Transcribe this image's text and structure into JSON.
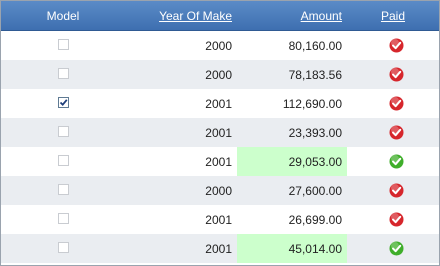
{
  "columns": {
    "model": "Model",
    "year": "Year Of Make",
    "amount": "Amount",
    "paid": "Paid"
  },
  "rows": [
    {
      "checked": false,
      "year": "2000",
      "amount": "80,160.00",
      "paid": "no",
      "highlight": false
    },
    {
      "checked": false,
      "year": "2000",
      "amount": "78,183.56",
      "paid": "no",
      "highlight": false
    },
    {
      "checked": true,
      "year": "2001",
      "amount": "112,690.00",
      "paid": "no",
      "highlight": false
    },
    {
      "checked": false,
      "year": "2001",
      "amount": "23,393.00",
      "paid": "no",
      "highlight": false
    },
    {
      "checked": false,
      "year": "2001",
      "amount": "29,053.00",
      "paid": "yes",
      "highlight": true
    },
    {
      "checked": false,
      "year": "2000",
      "amount": "27,600.00",
      "paid": "no",
      "highlight": false
    },
    {
      "checked": false,
      "year": "2001",
      "amount": "26,699.00",
      "paid": "no",
      "highlight": false
    },
    {
      "checked": false,
      "year": "2001",
      "amount": "45,014.00",
      "paid": "yes",
      "highlight": true
    }
  ],
  "icons": {
    "unpaid": "red-check-badge-icon",
    "paid": "green-check-badge-icon",
    "checkbox": "checkbox-icon"
  },
  "colors": {
    "header_top": "#5b8bc7",
    "header_bottom": "#3e6fb0",
    "row_alt": "#eaedf1",
    "highlight": "#ccffcc",
    "unpaid": "#d6262c",
    "paid": "#3fae2a"
  }
}
